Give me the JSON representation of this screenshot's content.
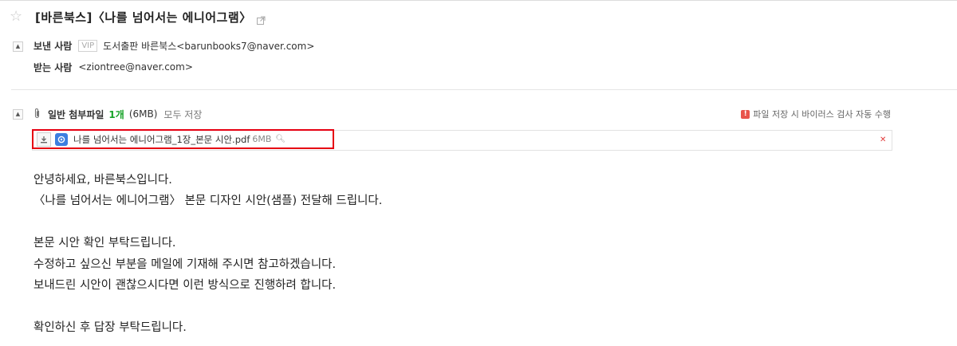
{
  "subject": "[바른북스]〈나를 넘어서는 에니어그램〉",
  "icons": {
    "star": "star-outline-icon",
    "popout": "popout-icon",
    "collapse": "collapse-toggle-icon",
    "attachment": "paperclip-icon",
    "download": "download-icon",
    "drive": "cloud-drive-icon",
    "preview": "magnifier-icon",
    "delete": "close-icon",
    "warning": "warning-icon"
  },
  "sender": {
    "label": "보낸 사람",
    "vip_badge": "VIP",
    "value": "도서출판 바른북스<barunbooks7@naver.com>"
  },
  "recipient": {
    "label": "받는 사람",
    "value": "<ziontree@naver.com>"
  },
  "attachments": {
    "title": "일반 첨부파일",
    "count": "1개",
    "total_size": "(6MB)",
    "save_all": "모두 저장",
    "virus_notice": "파일 저장 시 바이러스 검사 자동 수행",
    "files": [
      {
        "name": "나를 넘어서는 에니어그램_1장_본문 시안.pdf",
        "size": "6MB"
      }
    ]
  },
  "body": {
    "lines": [
      "안녕하세요, 바른북스입니다.",
      "〈나를 넘어서는 에니어그램〉 본문 디자인 시안(샘플) 전달해 드립니다.",
      "",
      "본문 시안 확인 부탁드립니다.",
      "수정하고 싶으신 부분을 메일에 기재해 주시면 참고하겠습니다.",
      "보내드린 시안이 괜찮으시다면 이런 방식으로 진행하려 합니다.",
      "",
      "확인하신 후 답장 부탁드립니다."
    ]
  },
  "colors": {
    "accent_green": "#19a32a",
    "highlight_red": "#e60012",
    "warning_red": "#e8544b",
    "drive_blue": "#3d7fe0"
  }
}
